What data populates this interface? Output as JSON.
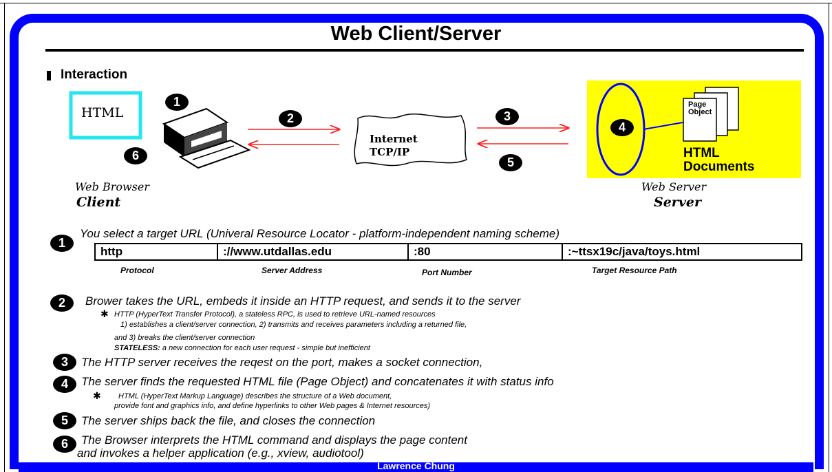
{
  "title": "Web Client/Server",
  "section": "Interaction",
  "diagram": {
    "html_box": "HTML",
    "internet_line1": "Internet",
    "internet_line2": "TCP/IP",
    "page_object_line1": "Page",
    "page_object_line2": "Object",
    "html_docs_line1": "HTML",
    "html_docs_line2": "Documents",
    "browser_label": "Web Browser",
    "client_label": "Client",
    "server_label_top": "Web Server",
    "server_label": "Server",
    "numbers": [
      "1",
      "2",
      "3",
      "4",
      "5",
      "6"
    ]
  },
  "url": {
    "parts": [
      "http",
      "://www.utdallas.edu",
      ":80",
      ":~ttsx19c/java/toys.html"
    ],
    "labels": [
      "Protocol",
      "Server Address",
      "Port Number",
      "Target Resource Path"
    ]
  },
  "steps": {
    "s1": "You select a target URL (Univeral Resource Locator - platform-independent naming scheme)",
    "s2": "Brower takes the URL, embeds it inside an HTTP request, and sends it to the server",
    "s2_sub1": "HTTP (HyperText Transfer Protocol), a stateless RPC,  is used to retrieve URL-named resources",
    "s2_sub2": "1) establishes a client/server connection, 2) transmits and receives parameters including a returned file,",
    "s2_sub3": "and 3) breaks the client/server connection",
    "s2_stateless_label": "STATELESS:",
    "s2_stateless_text": "a new connection for each user request - simple but inefficient",
    "s3": "The HTTP server receives the reqest on the port, makes a socket connection,",
    "s4": "The server finds the requested HTML file (Page Object) and concatenates it with status info",
    "s4_sub1": "HTML (HyperText Markup Language) describes the structure of a Web document,",
    "s4_sub2": "provide font and graphics info, and define hyperlinks to other Web pages & Internet resources)",
    "s5": "The server ships back the file, and closes the connection",
    "s6_line1": "The Browser interprets the HTML command and displays the page content",
    "s6_line2": "and invokes a helper application (e.g., xview, audiotool)"
  },
  "footer": "Lawrence Chung",
  "colors": {
    "frame": "#0000ff",
    "html_box_border": "#22e6f0",
    "server_fill": "#ffff00",
    "arrow": "#ff2020",
    "ellipse": "#0000ff"
  }
}
